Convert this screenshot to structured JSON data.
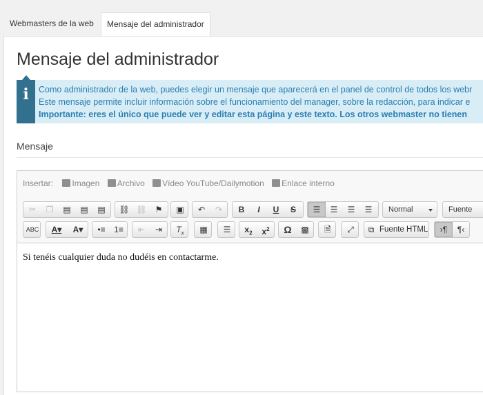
{
  "tabs": [
    {
      "label": "Webmasters de la web"
    },
    {
      "label": "Mensaje del administrador"
    }
  ],
  "page": {
    "title": "Mensaje del administrador"
  },
  "info": {
    "line1": "Como administrador de la web, puedes elegir un mensaje que aparecerá en el panel de control de todos los webr",
    "line2": "Este mensaje permite incluir información sobre el funcionamiento del manager, sobre la redacción, para indicar e",
    "line3": "Importante: eres el único que puede ver y editar esta página y este texto. Los otros webmaster no tienen"
  },
  "section": {
    "label": "Mensaje"
  },
  "insert": {
    "label": "Insertar:",
    "items": [
      "Imagen",
      "Archivo",
      "Vídeo YouTube/Dailymotion",
      "Enlace interno"
    ]
  },
  "toolbar": {
    "format_value": "Normal",
    "font_value": "Fuente",
    "source_label": "Fuente HTML"
  },
  "editor": {
    "content": "Si tenéis cualquier duda no dudéis en contactarme."
  },
  "colors": {
    "info_bg": "#d9edf7",
    "info_icon": "#31708f",
    "info_text": "#2a7fb0"
  }
}
